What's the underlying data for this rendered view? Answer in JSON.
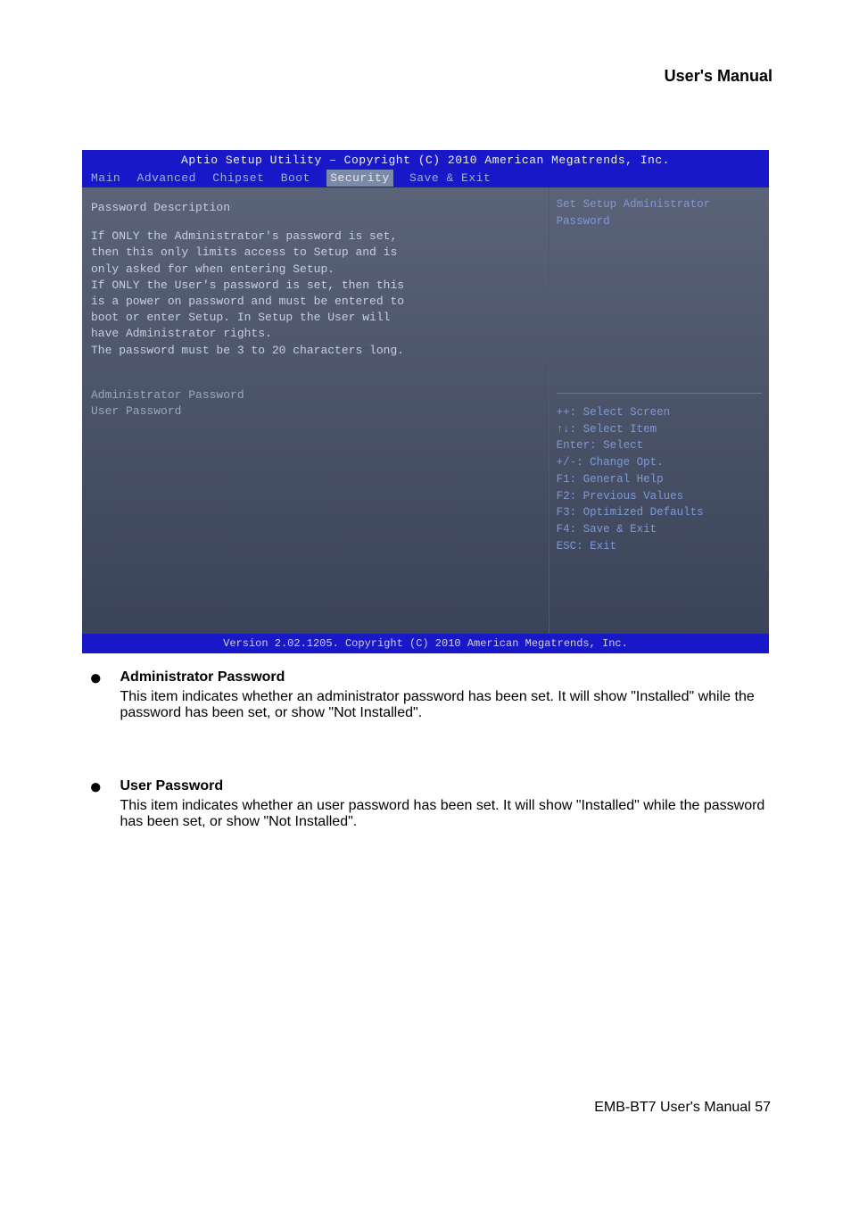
{
  "header": {
    "title": "User's Manual"
  },
  "bios": {
    "title": "Aptio Setup Utility – Copyright (C) 2010 American Megatrends, Inc.",
    "menu": {
      "main": "Main",
      "advanced": "Advanced",
      "chipset": "Chipset",
      "boot": "Boot",
      "security": "Security",
      "save_exit": "Save & Exit"
    },
    "left": {
      "heading": "Password Description",
      "line1": "If ONLY the Administrator's password is set,",
      "line2": "then this only limits access to Setup and is",
      "line3": "only asked for when entering Setup.",
      "line4": "If ONLY the User's password is set, then this",
      "line5": "is a power on password and must be entered to",
      "line6": "boot or enter Setup. In Setup the User will",
      "line7": "have Administrator rights.",
      "line8": "The password must be 3 to 20 characters long.",
      "item_admin": "Administrator Password",
      "item_user": "User Password"
    },
    "right_top": {
      "line1": "Set Setup Administrator",
      "line2": "Password"
    },
    "right_bottom": {
      "l1": "++: Select Screen",
      "l2": "↑↓: Select Item",
      "l3": "Enter: Select",
      "l4": "+/-: Change Opt.",
      "l5": "F1: General Help",
      "l6": "F2: Previous Values",
      "l7": "F3: Optimized Defaults",
      "l8": "F4: Save & Exit",
      "l9": "ESC: Exit"
    },
    "footer": "Version 2.02.1205. Copyright (C) 2010 American Megatrends, Inc."
  },
  "bullets": {
    "b1": {
      "title": "Administrator Password",
      "desc": "This item indicates whether an administrator password has been set. It will show \"Installed\" while the password has been set, or show \"Not Installed\"."
    },
    "b2": {
      "title": "User Password",
      "desc": "This item indicates whether an user password has been set. It will show \"Installed\" while the password has been set, or show \"Not Installed\"."
    }
  },
  "footer_page": {
    "label": "EMB-BT7 User's Manual   57"
  }
}
